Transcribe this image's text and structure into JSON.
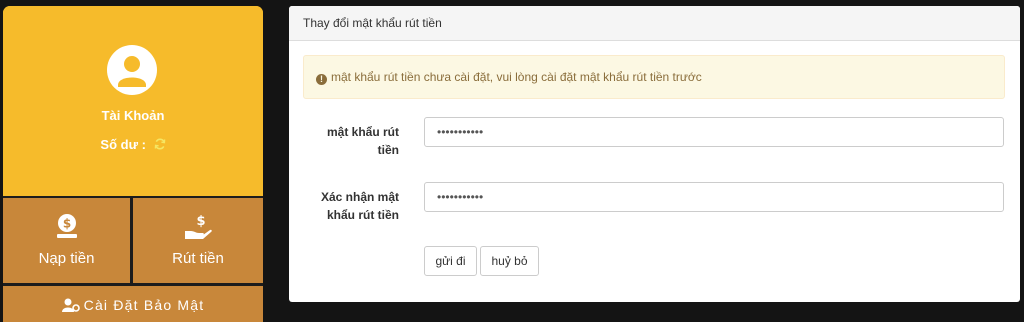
{
  "account": {
    "name_label": "Tài Khoản",
    "balance_label": "Số dư :",
    "actions": {
      "deposit_label": "Nạp tiền",
      "withdraw_label": "Rút tiền",
      "security_label": "Cài Đặt Bảo Mật"
    }
  },
  "panel": {
    "title": "Thay đổi mật khẩu rút tiền",
    "alert_text": "mật khẩu rút tiền chưa cài đặt, vui lòng cài đặt mật khẩu rút tiền trước",
    "form": {
      "password_label_line1": "mật khẩu rút",
      "password_label_line2": "tiền",
      "password_value": "•••••••••••",
      "confirm_label_line1": "Xác nhận mật",
      "confirm_label_line2": "khẩu rút tiền",
      "confirm_value": "•••••••••••"
    },
    "buttons": {
      "submit_label": "gửi đi",
      "cancel_label": "huỷ bỏ"
    }
  },
  "colors": {
    "account_header": "#f6bb2b",
    "action_tile": "#c8873a",
    "page_background": "#141414",
    "alert_background": "#fcf8e3"
  },
  "icons": {
    "avatar": "user-circle-icon",
    "balance": "refresh-icon",
    "deposit": "money-bag-icon",
    "withdraw": "hand-money-icon",
    "security": "user-gear-icon",
    "alert": "info-circle-icon"
  }
}
